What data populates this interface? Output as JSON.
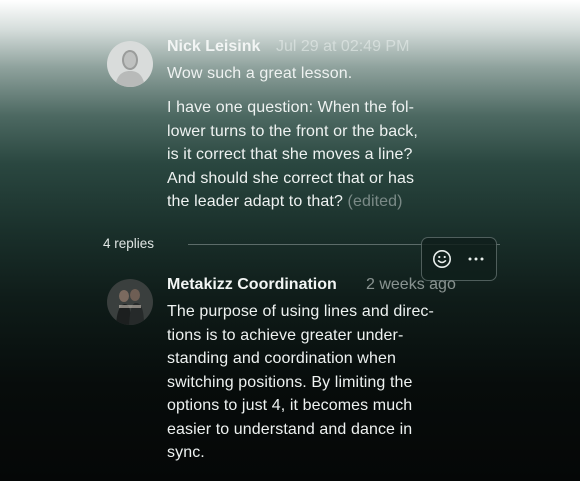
{
  "comment": {
    "author": "Nick Leisink",
    "timestamp": "Jul 29 at 02:49 PM",
    "line1": "Wow such a great lesson.",
    "body_lines": [
      "I have one question: When the fol-",
      "lower turns to the front or the back,",
      "is it correct that she moves a line?",
      "And should she correct that or has",
      "the leader adapt to that?"
    ],
    "edited_label": "(edited)"
  },
  "thread": {
    "replies_label": "4 replies"
  },
  "toolbar": {
    "react_icon": "smiley-icon",
    "more_icon": "ellipsis-icon"
  },
  "reply": {
    "author": "Metakizz Coordination",
    "timestamp": "2 weeks ago",
    "body_lines": [
      "The purpose of using lines and direc-",
      "tions is to achieve greater under-",
      "standing and coordination when",
      "switching positions. By limiting the",
      "options to just 4, it becomes much",
      "easier to understand and dance in",
      "sync."
    ]
  }
}
